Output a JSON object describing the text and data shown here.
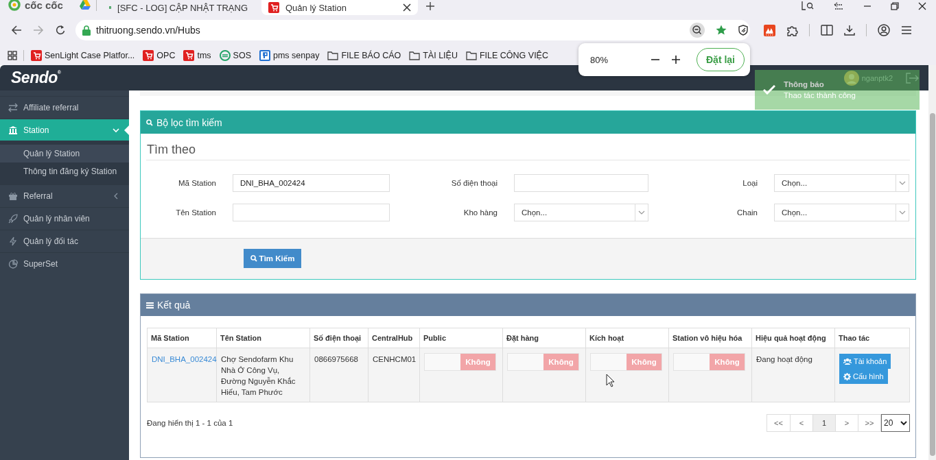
{
  "browser": {
    "brand": "cốc cốc",
    "tabs": [
      {
        "title": "[SFC - LOG] CẬP NHẬT TRẠNG",
        "kind": "sheet",
        "selected": false
      },
      {
        "title": "Quản lý Station",
        "kind": "sendo",
        "selected": true
      }
    ],
    "url": "thitruong.sendo.vn/Hubs",
    "bookmarks": [
      {
        "label": "SenLight Case Platfor...",
        "kind": "sendo"
      },
      {
        "label": "OPC",
        "kind": "sendo"
      },
      {
        "label": "tms",
        "kind": "sendo"
      },
      {
        "label": "SOS",
        "kind": "sos"
      },
      {
        "label": "pms senpay",
        "kind": "pms"
      },
      {
        "label": "FILE BÁO CÁO",
        "kind": "folder"
      },
      {
        "label": "TÀI LIỆU",
        "kind": "folder"
      },
      {
        "label": "FILE CÔNG VIỆC",
        "kind": "folder"
      }
    ],
    "zoom_popup": {
      "zoom_text": "80%",
      "reset_button": "Đặt lại"
    }
  },
  "app": {
    "logo": "Sendo$^{®}$",
    "user": "nganptk2"
  },
  "notification": {
    "title": "Thông báo",
    "message": "Thao tác thành công"
  },
  "sidebar": {
    "items": [
      {
        "label": "Affiliate referral",
        "selected": false
      },
      {
        "label": "Station",
        "selected": true,
        "expanded": true,
        "children": [
          {
            "label": "Quản lý Station",
            "selected": true
          },
          {
            "label": "Thông tin đăng ký Station",
            "selected": false
          }
        ]
      },
      {
        "label": "Referral",
        "selected": false,
        "expanded": false
      },
      {
        "label": "Quản lý nhân viên",
        "selected": false
      },
      {
        "label": "Quản lý đối tác",
        "selected": false
      },
      {
        "label": "SuperSet",
        "selected": false
      }
    ]
  },
  "filter_panel": {
    "title": "Bộ lọc tìm kiếm",
    "heading": "Tìm theo",
    "fields": [
      {
        "label": "Mã Station",
        "kind": "text",
        "value": "DNI_BHA_002424"
      },
      {
        "label": "Số điện thoại",
        "kind": "text"
      },
      {
        "label": "Loại",
        "kind": "select",
        "placeholder": "Chọn..."
      },
      {
        "label": "Tên Station",
        "kind": "text"
      },
      {
        "label": "Kho hàng",
        "kind": "select",
        "placeholder": "Chọn..."
      },
      {
        "label": "Chain",
        "kind": "select",
        "placeholder": "Chọn..."
      }
    ],
    "search_button": "Tìm Kiếm"
  },
  "results_panel": {
    "title": "Kết quả",
    "table": {
      "columns": [
        "Mã Station",
        "Tên Station",
        "Số điện thoại",
        "CentralHub",
        "Public",
        "Đặt hàng",
        "Kích hoạt",
        "Station vô hiệu hóa",
        "Hiệu quả hoạt động",
        "Thao tác"
      ],
      "rows": [
        {
          "code": "DNI_BHA_002424",
          "name": "Chợ Sendofarm Khu Nhà Ở Công Vụ, Đường Nguyễn Khắc Hiếu, Tam Phước",
          "phone": "0866975668",
          "central_hub": "CENHCM01",
          "toggles": [
            {
              "label": "Không",
              "on": false
            },
            {
              "label": "Không",
              "on": false
            },
            {
              "label": "Không",
              "on": false
            },
            {
              "label": "Không",
              "on": false
            }
          ],
          "performance": "Đang hoạt động",
          "actions": [
            {
              "label": "Tài khoản",
              "kind": "users"
            },
            {
              "label": "Cấu hình",
              "kind": "gear"
            }
          ]
        }
      ]
    },
    "summary": "Đang hiển thị 1 - 1 của 1",
    "pagination": [
      {
        "label": "<<",
        "selected": false
      },
      {
        "label": "<",
        "selected": false
      },
      {
        "label": "1",
        "selected": true
      },
      {
        "label": ">",
        "selected": false
      },
      {
        "label": ">>",
        "selected": false
      }
    ],
    "page_size": "20"
  }
}
